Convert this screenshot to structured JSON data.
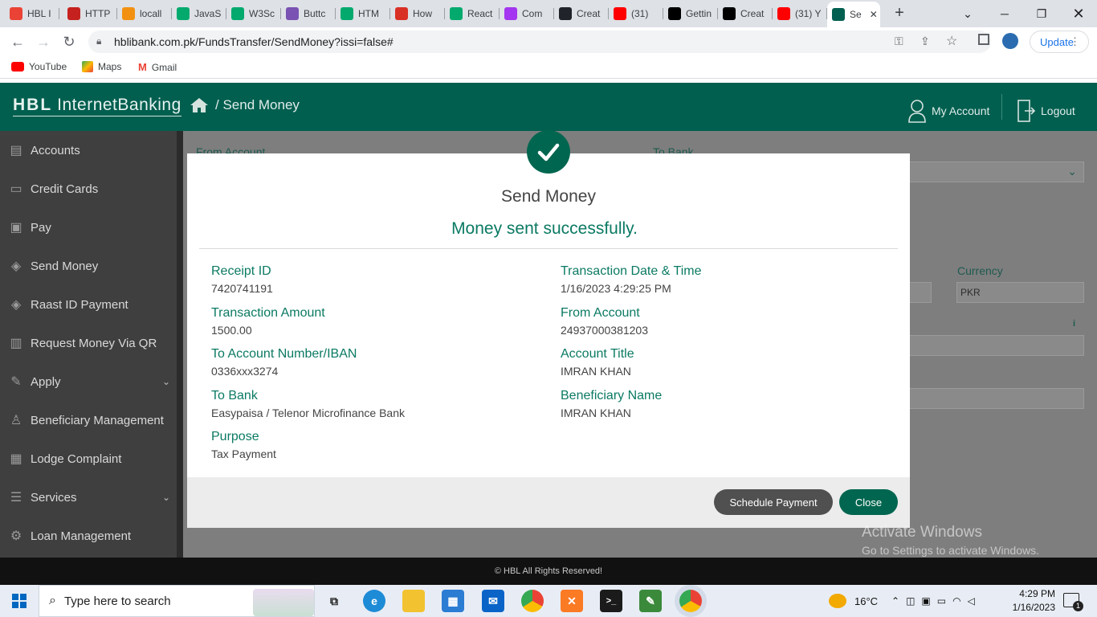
{
  "browser": {
    "tabs": [
      {
        "label": "HBL I",
        "icon": "gmail-icon",
        "color": "#ea4335"
      },
      {
        "label": "HTTP",
        "icon": "pages-icon",
        "color": "#c5221f"
      },
      {
        "label": "locall",
        "icon": "phpmyadmin-icon",
        "color": "#f29111"
      },
      {
        "label": "JavaS",
        "icon": "w3schools-icon",
        "color": "#04aa6d"
      },
      {
        "label": "W3Sc",
        "icon": "w3schools-icon",
        "color": "#04aa6d"
      },
      {
        "label": "Buttc",
        "icon": "bootstrap-icon",
        "color": "#7952b3"
      },
      {
        "label": "HTM",
        "icon": "w3schools-icon",
        "color": "#04aa6d"
      },
      {
        "label": "How",
        "icon": "codecademy-icon",
        "color": "#d93025"
      },
      {
        "label": "React",
        "icon": "w3schools-icon",
        "color": "#04aa6d"
      },
      {
        "label": "Com",
        "icon": "udemy-icon",
        "color": "#a435f0"
      },
      {
        "label": "Creat",
        "icon": "react-icon",
        "color": "#20232a"
      },
      {
        "label": "(31)",
        "icon": "youtube-icon",
        "color": "#ff0000"
      },
      {
        "label": "Gettin",
        "icon": "nextjs-icon",
        "color": "#000000"
      },
      {
        "label": "Creat",
        "icon": "vercel-icon",
        "color": "#000000"
      },
      {
        "label": "(31) Y",
        "icon": "youtube-icon",
        "color": "#ff0000"
      },
      {
        "label": "Se",
        "icon": "hbl-icon",
        "color": "#005f4f"
      }
    ],
    "url": "hblibank.com.pk/FundsTransfer/SendMoney?issi=false#",
    "update_label": "Update",
    "bookmarks": [
      {
        "label": "YouTube",
        "icon": "youtube-icon"
      },
      {
        "label": "Maps",
        "icon": "maps-icon"
      },
      {
        "label": "Gmail",
        "icon": "gmail-icon"
      }
    ]
  },
  "header": {
    "logo_bold": "HBL",
    "logo_text": "InternetBanking",
    "breadcrumb": "/ Send Money",
    "my_account": "My Account",
    "logout": "Logout"
  },
  "sidebar": {
    "items": [
      {
        "label": "Accounts",
        "icon": "accounts-icon"
      },
      {
        "label": "Credit Cards",
        "icon": "credit-card-icon"
      },
      {
        "label": "Pay",
        "icon": "wallet-icon"
      },
      {
        "label": "Send Money",
        "icon": "money-icon"
      },
      {
        "label": "Raast ID Payment",
        "icon": "raast-icon"
      },
      {
        "label": "Request Money Via QR",
        "icon": "qr-icon"
      },
      {
        "label": "Apply",
        "icon": "apply-icon"
      },
      {
        "label": "Beneficiary Management",
        "icon": "person-icon"
      },
      {
        "label": "Lodge Complaint",
        "icon": "complaint-icon"
      },
      {
        "label": "Services",
        "icon": "services-icon"
      },
      {
        "label": "Loan Management",
        "icon": "loan-icon"
      }
    ]
  },
  "form_background": {
    "from_account_label": "From Account",
    "to_bank_label": "To Bank",
    "currency_label": "Currency",
    "currency_value": "PKR"
  },
  "modal": {
    "title": "Send Money",
    "success": "Money sent successfully.",
    "fields": {
      "receipt_id": {
        "label": "Receipt ID",
        "value": "7420741191"
      },
      "txn_datetime": {
        "label": "Transaction Date & Time",
        "value": "1/16/2023 4:29:25 PM"
      },
      "amount": {
        "label": "Transaction Amount",
        "value": "1500.00"
      },
      "from_account": {
        "label": "From Account",
        "value": "24937000381203"
      },
      "to_account": {
        "label": "To Account Number/IBAN",
        "value": "0336xxx3274"
      },
      "account_title": {
        "label": "Account Title",
        "value": "IMRAN KHAN"
      },
      "to_bank": {
        "label": "To Bank",
        "value": "Easypaisa / Telenor Microfinance Bank"
      },
      "beneficiary": {
        "label": "Beneficiary Name",
        "value": "IMRAN KHAN"
      },
      "purpose": {
        "label": "Purpose",
        "value": "Tax Payment"
      }
    },
    "schedule_label": "Schedule Payment",
    "close_label": "Close"
  },
  "footer": "© HBL All Rights Reserved!",
  "watermark": {
    "line1": "Activate Windows",
    "line2": "Go to Settings to activate Windows."
  },
  "taskbar": {
    "search_placeholder": "Type here to search",
    "temperature": "16°C",
    "time": "4:29 PM",
    "date": "1/16/2023"
  },
  "colors": {
    "brand": "#005f4f",
    "accent": "#0b7a63"
  }
}
